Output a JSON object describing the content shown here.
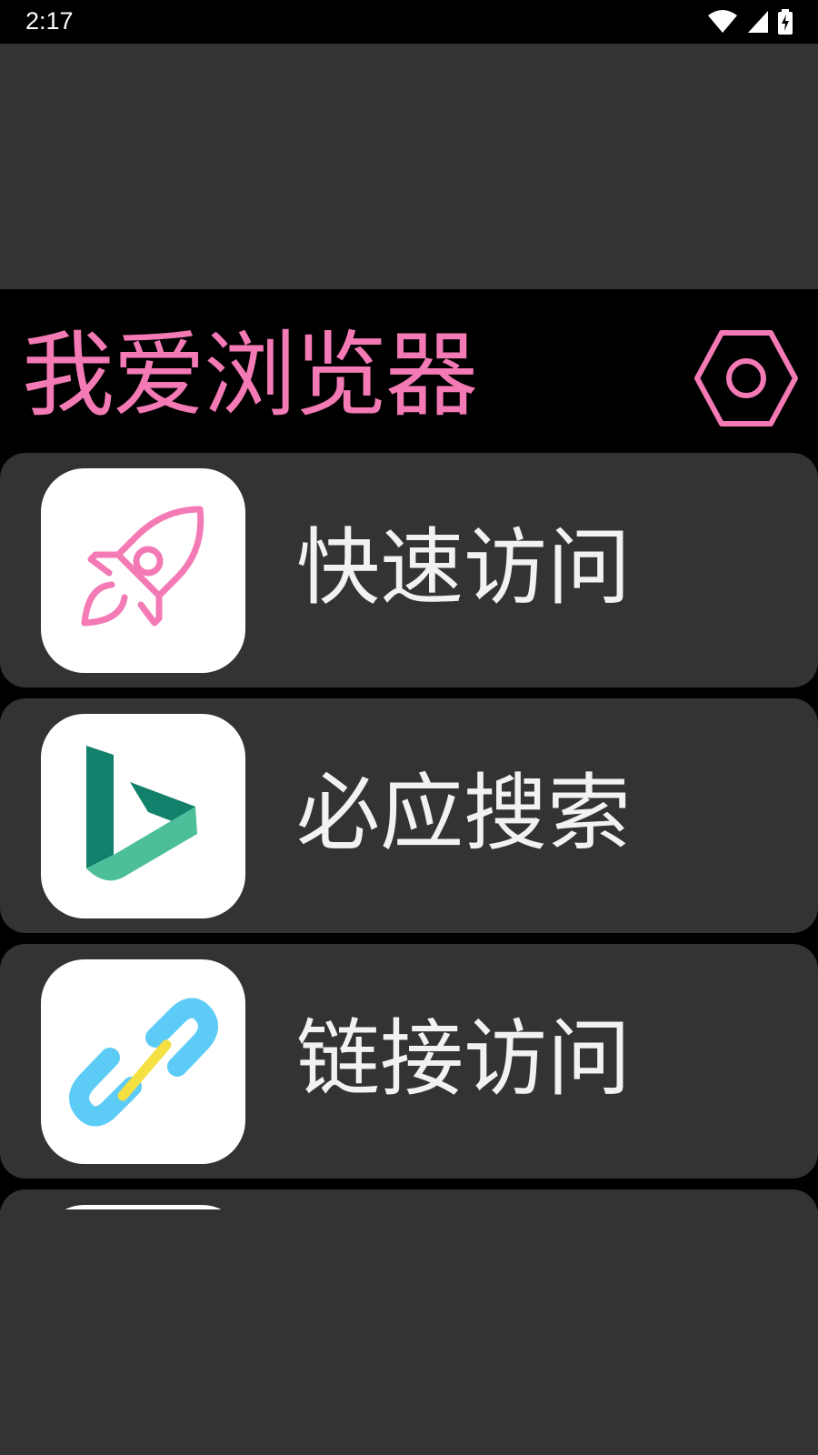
{
  "status_bar": {
    "time": "2:17",
    "icons": [
      "wifi-icon",
      "cellular-signal-icon",
      "battery-charging-icon"
    ]
  },
  "header": {
    "title": "我爱浏览器",
    "settings_icon": "settings-hexagon-icon"
  },
  "items": [
    {
      "label": "快速访问",
      "icon": "rocket-icon"
    },
    {
      "label": "必应搜索",
      "icon": "bing-icon"
    },
    {
      "label": "链接访问",
      "icon": "link-icon"
    },
    {
      "label": "",
      "icon": ""
    }
  ],
  "colors": {
    "accent_pink": "#f47ab5",
    "card_background": "#333333",
    "app_background": "#000000",
    "bing_dark": "#12806b",
    "bing_light": "#4cbf9a",
    "link_blue": "#5ccbf5",
    "link_yellow": "#f5e042"
  }
}
